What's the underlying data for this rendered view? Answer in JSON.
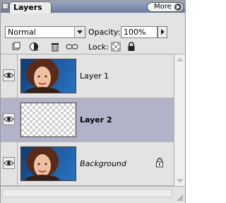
{
  "panel": {
    "tab_label": "Layers",
    "menu_button_label": "More"
  },
  "controls": {
    "blend_mode": "Normal",
    "opacity_label": "Opacity:",
    "opacity_value": "100%",
    "lock_label": "Lock:"
  },
  "layers": [
    {
      "name": "Layer 1",
      "visible": true,
      "thumbnail": "photo",
      "selected": false,
      "locked": false
    },
    {
      "name": "Layer 2",
      "visible": true,
      "thumbnail": "transparent",
      "selected": true,
      "locked": false
    },
    {
      "name": "Background",
      "visible": true,
      "thumbnail": "photo",
      "selected": false,
      "locked": true
    }
  ],
  "colors": {
    "selected_row": "#b2b3c8",
    "panel_bg": "#e3e3e3",
    "photo_bg": "#1b5aa0"
  },
  "icons": [
    "close-box-icon",
    "new-layer-icon",
    "adjustment-icon",
    "trash-icon",
    "link-icon",
    "lock-transparency-icon",
    "lock-all-icon",
    "eye-icon",
    "layer-lock-icon"
  ]
}
